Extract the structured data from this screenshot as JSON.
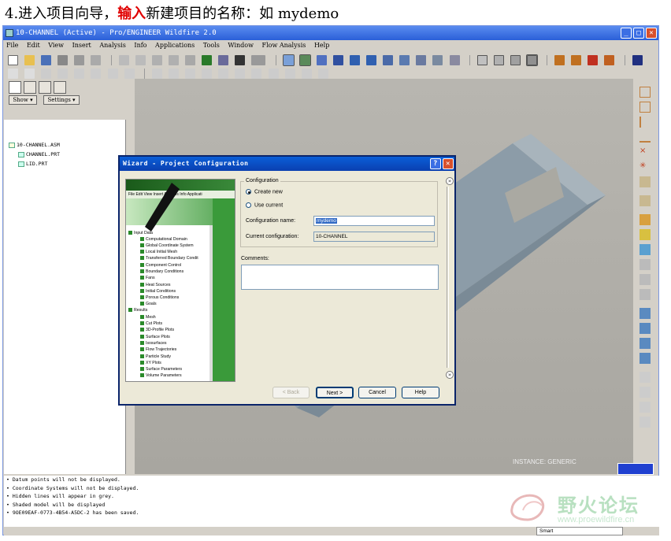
{
  "caption": {
    "prefix": "4.进入项目向导，",
    "highlight": "输入",
    "suffix": "新建项目的名称：如  mydemo"
  },
  "window": {
    "title": "10-CHANNEL (Active) - Pro/ENGINEER Wildfire 2.0",
    "menu": [
      "File",
      "Edit",
      "View",
      "Insert",
      "Analysis",
      "Info",
      "Applications",
      "Tools",
      "Window",
      "Flow Analysis",
      "Help"
    ]
  },
  "navigator": {
    "show_label": "Show ▾",
    "settings_label": "Settings ▾",
    "tree": [
      "10-CHANNEL.ASM",
      "CHANNEL.PRT",
      "LID.PRT"
    ]
  },
  "viewport": {
    "instance_label": "INSTANCE: GENERIC"
  },
  "messages": [
    "• Datum points will not be displayed.",
    "• Coordinate Systems will not be displayed.",
    "• Hidden lines will appear in grey.",
    "• Shaded model will be displayed",
    "• 9OE09EAF-0773-4B54-A5DC-2 has been saved."
  ],
  "status": {
    "smart_label": "Smart"
  },
  "wizard": {
    "title": "Wizard - Project Configuration",
    "group_label": "Configuration",
    "option_create": "Create new",
    "option_use": "Use current",
    "name_label": "Configuration name:",
    "name_value": "mydemo",
    "current_label": "Current configuration:",
    "current_value": "10-CHANNEL",
    "comments_label": "Comments:",
    "comments_value": "",
    "back_label": "< Back",
    "next_label": "Next >",
    "cancel_label": "Cancel",
    "help_label": "Help",
    "preview_menu": [
      "File",
      "Edit",
      "View",
      "Insert",
      "Analysis",
      "Info",
      "Applicati"
    ],
    "preview_tree": [
      "Input Data",
      "Computational Domain",
      "Global Coordinate System",
      "Local Initial Mesh",
      "Transferred Boundary Condit",
      "Component Control",
      "Boundary Conditions",
      "Fans",
      "Heat Sources",
      "Initial Conditions",
      "Porous Conditions",
      "Goals",
      "Results",
      "Mesh",
      "Cut Plots",
      "3D-Profile Plots",
      "Surface Plots",
      "Isosurfaces",
      "Flow Trajectories",
      "Particle Study",
      "XY Plots",
      "Surface Parameters",
      "Volume Parameters"
    ]
  },
  "watermark": {
    "text": "野火论坛",
    "url": "www.proewildfire.cn"
  }
}
